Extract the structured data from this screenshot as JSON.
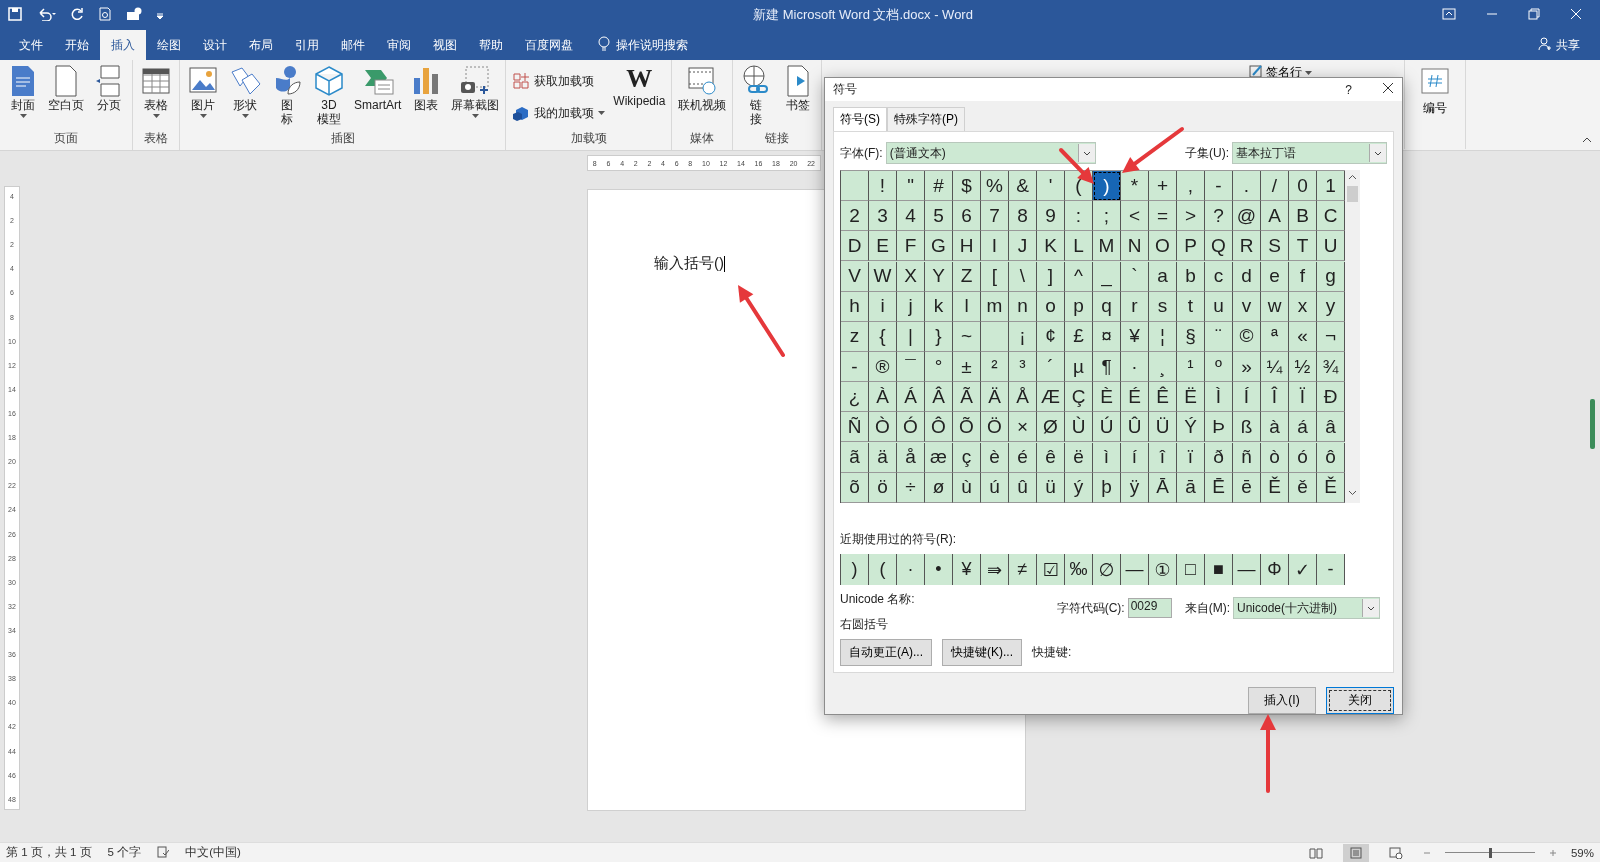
{
  "title_bar": {
    "title": "新建 Microsoft Word 文档.docx  -  Word"
  },
  "menu_tabs": [
    {
      "label": "文件",
      "selected": false
    },
    {
      "label": "开始",
      "selected": false
    },
    {
      "label": "插入",
      "selected": true
    },
    {
      "label": "绘图",
      "selected": false
    },
    {
      "label": "设计",
      "selected": false
    },
    {
      "label": "布局",
      "selected": false
    },
    {
      "label": "引用",
      "selected": false
    },
    {
      "label": "邮件",
      "selected": false
    },
    {
      "label": "审阅",
      "selected": false
    },
    {
      "label": "视图",
      "selected": false
    },
    {
      "label": "帮助",
      "selected": false
    },
    {
      "label": "百度网盘",
      "selected": false
    }
  ],
  "tell_me": "操作说明搜索",
  "share": "共享",
  "ribbon": {
    "groups": [
      {
        "label": "页面",
        "items": [
          {
            "label": "封面",
            "kind": "cover",
            "dropdown": true
          },
          {
            "label": "空白页",
            "kind": "blank",
            "dropdown": false
          },
          {
            "label": "分页",
            "kind": "pagebreak",
            "dropdown": false
          }
        ]
      },
      {
        "label": "表格",
        "items": [
          {
            "label": "表格",
            "kind": "table",
            "dropdown": true
          }
        ]
      },
      {
        "label": "插图",
        "items": [
          {
            "label": "图片",
            "kind": "picture",
            "dropdown": true
          },
          {
            "label": "形状",
            "kind": "shapes",
            "dropdown": true
          },
          {
            "label": "图标",
            "kind": "icons",
            "vertical": true,
            "dropdown": false
          },
          {
            "label": "3D\n模型",
            "kind": "model3d",
            "dropdown": false
          },
          {
            "label": "SmartArt",
            "kind": "smartart",
            "dropdown": false
          },
          {
            "label": "图表",
            "kind": "chart",
            "dropdown": false
          },
          {
            "label": "屏幕截图",
            "kind": "screenshot",
            "dropdown": true
          }
        ]
      },
      {
        "label": "加载项",
        "items": [
          {
            "label": "获取加载项",
            "kind": "store",
            "dropdown": false
          },
          {
            "label": "我的加载项",
            "kind": "myaddins",
            "dropdown": true
          },
          {
            "label": "Wikipedia",
            "kind": "wikipedia",
            "logo": "W",
            "dropdown": false
          }
        ]
      },
      {
        "label": "媒体",
        "items": [
          {
            "label": "联机视频",
            "kind": "video",
            "dropdown": false
          }
        ]
      },
      {
        "label": "链接",
        "items": [
          {
            "label": "链接",
            "kind": "link",
            "vertical": true,
            "dropdown": false
          },
          {
            "label": "书签",
            "kind": "bookmark",
            "dropdown": false
          }
        ]
      }
    ],
    "signature_line": "签名行",
    "numbering": "编号"
  },
  "document": {
    "text": "输入括号()",
    "ruler_numbers": [
      "8",
      "6",
      "4",
      "2",
      "2",
      "4",
      "6",
      "8",
      "10",
      "12",
      "14",
      "16",
      "18",
      "20",
      "22"
    ],
    "vertical_ruler_numbers": [
      "4",
      "2",
      "2",
      "4",
      "6",
      "8",
      "10",
      "12",
      "14",
      "16",
      "18",
      "20",
      "22",
      "24",
      "26",
      "28",
      "30",
      "32",
      "34",
      "36",
      "38",
      "40",
      "42",
      "44",
      "46",
      "48"
    ]
  },
  "symbol_dialog": {
    "title": "符号",
    "help": "?",
    "tabs": [
      {
        "label": "符号(S)",
        "selected": true
      },
      {
        "label": "特殊字符(P)",
        "selected": false
      }
    ],
    "font_label": "字体(F):",
    "font_value": "(普通文本)",
    "subset_label": "子集(U):",
    "subset_value": "基本拉丁语",
    "grid": [
      [
        {
          "selected": false
        },
        {
          "char": "!",
          "selected": false
        },
        {
          "char": "\"",
          "selected": false
        },
        {
          "char": "#",
          "selected": false
        },
        {
          "char": "$",
          "selected": false
        },
        {
          "char": "%",
          "selected": false
        },
        {
          "char": "&",
          "selected": false
        },
        {
          "char": "'",
          "selected": false
        },
        {
          "char": "(",
          "selected": false
        },
        {
          "char": ")",
          "selected": true
        },
        {
          "char": "*",
          "selected": false
        },
        {
          "char": "+",
          "selected": false
        },
        {
          "char": ",",
          "selected": false
        },
        {
          "char": "-",
          "selected": false
        },
        {
          "char": ".",
          "selected": false
        },
        {
          "char": "/",
          "selected": false
        },
        {
          "char": "0",
          "selected": false
        },
        {
          "char": "1",
          "selected": false
        }
      ],
      [
        {
          "char": "2",
          "selected": false
        },
        {
          "char": "3",
          "selected": false
        },
        {
          "char": "4",
          "selected": false
        },
        {
          "char": "5",
          "selected": false
        },
        {
          "char": "6",
          "selected": false
        },
        {
          "char": "7",
          "selected": false
        },
        {
          "char": "8",
          "selected": false
        },
        {
          "char": "9",
          "selected": false
        },
        {
          "char": ":",
          "selected": false
        },
        {
          "char": ";",
          "selected": false
        },
        {
          "char": "<",
          "selected": false
        },
        {
          "char": "=",
          "selected": false
        },
        {
          "char": ">",
          "selected": false
        },
        {
          "char": "?",
          "selected": false
        },
        {
          "char": "@",
          "selected": false
        },
        {
          "char": "A",
          "selected": false
        },
        {
          "char": "B",
          "selected": false
        },
        {
          "char": "C",
          "selected": false
        }
      ],
      [
        {
          "char": "D",
          "selected": false
        },
        {
          "char": "E",
          "selected": false
        },
        {
          "char": "F",
          "selected": false
        },
        {
          "char": "G",
          "selected": false
        },
        {
          "char": "H",
          "selected": false
        },
        {
          "char": "I",
          "selected": false
        },
        {
          "char": "J",
          "selected": false
        },
        {
          "char": "K",
          "selected": false
        },
        {
          "char": "L",
          "selected": false
        },
        {
          "char": "M",
          "selected": false
        },
        {
          "char": "N",
          "selected": false
        },
        {
          "char": "O",
          "selected": false
        },
        {
          "char": "P",
          "selected": false
        },
        {
          "char": "Q",
          "selected": false
        },
        {
          "char": "R",
          "selected": false
        },
        {
          "char": "S",
          "selected": false
        },
        {
          "char": "T",
          "selected": false
        },
        {
          "char": "U",
          "selected": false
        }
      ],
      [
        {
          "char": "V",
          "selected": false
        },
        {
          "char": "W",
          "selected": false
        },
        {
          "char": "X",
          "selected": false
        },
        {
          "char": "Y",
          "selected": false
        },
        {
          "char": "Z",
          "selected": false
        },
        {
          "char": "[",
          "selected": false
        },
        {
          "char": "\\",
          "selected": false
        },
        {
          "char": "]",
          "selected": false
        },
        {
          "char": "^",
          "selected": false
        },
        {
          "char": "_",
          "selected": false
        },
        {
          "char": "`",
          "selected": false
        },
        {
          "char": "a",
          "selected": false
        },
        {
          "char": "b",
          "selected": false
        },
        {
          "char": "c",
          "selected": false
        },
        {
          "char": "d",
          "selected": false
        },
        {
          "char": "e",
          "selected": false
        },
        {
          "char": "f",
          "selected": false
        },
        {
          "char": "g",
          "selected": false
        }
      ],
      [
        {
          "char": "h",
          "selected": false
        },
        {
          "char": "i",
          "selected": false
        },
        {
          "char": "j",
          "selected": false
        },
        {
          "char": "k",
          "selected": false
        },
        {
          "char": "l",
          "selected": false
        },
        {
          "char": "m",
          "selected": false
        },
        {
          "char": "n",
          "selected": false
        },
        {
          "char": "o",
          "selected": false
        },
        {
          "char": "p",
          "selected": false
        },
        {
          "char": "q",
          "selected": false
        },
        {
          "char": "r",
          "selected": false
        },
        {
          "char": "s",
          "selected": false
        },
        {
          "char": "t",
          "selected": false
        },
        {
          "char": "u",
          "selected": false
        },
        {
          "char": "v",
          "selected": false
        },
        {
          "char": "w",
          "selected": false
        },
        {
          "char": "x",
          "selected": false
        },
        {
          "char": "y",
          "selected": false
        }
      ],
      [
        {
          "char": "z",
          "selected": false
        },
        {
          "char": "{",
          "selected": false
        },
        {
          "char": "|",
          "selected": false
        },
        {
          "char": "}",
          "selected": false
        },
        {
          "char": "~",
          "selected": false
        },
        {
          "selected": false
        },
        {
          "char": "¡",
          "selected": false
        },
        {
          "char": "¢",
          "selected": false
        },
        {
          "char": "£",
          "selected": false
        },
        {
          "char": "¤",
          "selected": false
        },
        {
          "char": "¥",
          "selected": false
        },
        {
          "char": "¦",
          "selected": false
        },
        {
          "char": "§",
          "selected": false
        },
        {
          "char": "¨",
          "selected": false
        },
        {
          "char": "©",
          "selected": false
        },
        {
          "char": "ª",
          "selected": false
        },
        {
          "char": "«",
          "selected": false
        },
        {
          "char": "¬",
          "selected": false
        }
      ],
      [
        {
          "char": "-",
          "selected": false
        },
        {
          "char": "®",
          "selected": false
        },
        {
          "char": "¯",
          "selected": false
        },
        {
          "char": "°",
          "selected": false
        },
        {
          "char": "±",
          "selected": false
        },
        {
          "char": "²",
          "selected": false
        },
        {
          "char": "³",
          "selected": false
        },
        {
          "char": "´",
          "selected": false
        },
        {
          "char": "µ",
          "selected": false
        },
        {
          "char": "¶",
          "selected": false
        },
        {
          "char": "·",
          "selected": false
        },
        {
          "char": "¸",
          "selected": false
        },
        {
          "char": "¹",
          "selected": false
        },
        {
          "char": "º",
          "selected": false
        },
        {
          "char": "»",
          "selected": false
        },
        {
          "char": "¼",
          "selected": false
        },
        {
          "char": "½",
          "selected": false
        },
        {
          "char": "¾",
          "selected": false
        }
      ],
      [
        {
          "char": "¿",
          "selected": false
        },
        {
          "char": "À",
          "selected": false
        },
        {
          "char": "Á",
          "selected": false
        },
        {
          "char": "Â",
          "selected": false
        },
        {
          "char": "Ã",
          "selected": false
        },
        {
          "char": "Ä",
          "selected": false
        },
        {
          "char": "Å",
          "selected": false
        },
        {
          "char": "Æ",
          "selected": false
        },
        {
          "char": "Ç",
          "selected": false
        },
        {
          "char": "È",
          "selected": false
        },
        {
          "char": "É",
          "selected": false
        },
        {
          "char": "Ê",
          "selected": false
        },
        {
          "char": "Ë",
          "selected": false
        },
        {
          "char": "Ì",
          "selected": false
        },
        {
          "char": "Í",
          "selected": false
        },
        {
          "char": "Î",
          "selected": false
        },
        {
          "char": "Ï",
          "selected": false
        },
        {
          "char": "Ð",
          "selected": false
        }
      ],
      [
        {
          "char": "Ñ",
          "selected": false
        },
        {
          "char": "Ò",
          "selected": false
        },
        {
          "char": "Ó",
          "selected": false
        },
        {
          "char": "Ô",
          "selected": false
        },
        {
          "char": "Õ",
          "selected": false
        },
        {
          "char": "Ö",
          "selected": false
        },
        {
          "char": "×",
          "selected": false
        },
        {
          "char": "Ø",
          "selected": false
        },
        {
          "char": "Ù",
          "selected": false
        },
        {
          "char": "Ú",
          "selected": false
        },
        {
          "char": "Û",
          "selected": false
        },
        {
          "char": "Ü",
          "selected": false
        },
        {
          "char": "Ý",
          "selected": false
        },
        {
          "char": "Þ",
          "selected": false
        },
        {
          "char": "ß",
          "selected": false
        },
        {
          "char": "à",
          "selected": false
        },
        {
          "char": "á",
          "selected": false
        },
        {
          "char": "â",
          "selected": false
        }
      ],
      [
        {
          "char": "ã",
          "selected": false
        },
        {
          "char": "ä",
          "selected": false
        },
        {
          "char": "å",
          "selected": false
        },
        {
          "char": "æ",
          "selected": false
        },
        {
          "char": "ç",
          "selected": false
        },
        {
          "char": "è",
          "selected": false
        },
        {
          "char": "é",
          "selected": false
        },
        {
          "char": "ê",
          "selected": false
        },
        {
          "char": "ë",
          "selected": false
        },
        {
          "char": "ì",
          "selected": false
        },
        {
          "char": "í",
          "selected": false
        },
        {
          "char": "î",
          "selected": false
        },
        {
          "char": "ï",
          "selected": false
        },
        {
          "char": "ð",
          "selected": false
        },
        {
          "char": "ñ",
          "selected": false
        },
        {
          "char": "ò",
          "selected": false
        },
        {
          "char": "ó",
          "selected": false
        },
        {
          "char": "ô",
          "selected": false
        }
      ],
      [
        {
          "char": "õ",
          "selected": false
        },
        {
          "char": "ö",
          "selected": false
        },
        {
          "char": "÷",
          "selected": false
        },
        {
          "char": "ø",
          "selected": false
        },
        {
          "char": "ù",
          "selected": false
        },
        {
          "char": "ú",
          "selected": false
        },
        {
          "char": "û",
          "selected": false
        },
        {
          "char": "ü",
          "selected": false
        },
        {
          "char": "ý",
          "selected": false
        },
        {
          "char": "þ",
          "selected": false
        },
        {
          "char": "ÿ",
          "selected": false
        },
        {
          "char": "Ā",
          "selected": false
        },
        {
          "char": "ā",
          "selected": false
        },
        {
          "char": "Ē",
          "selected": false
        },
        {
          "char": "ē",
          "selected": false
        },
        {
          "char": "Ě",
          "selected": false
        },
        {
          "char": "ě",
          "selected": false
        },
        {
          "char": "Ě",
          "selected": false
        }
      ]
    ],
    "recent_label": "近期使用过的符号(R):",
    "recent": [
      ")",
      "(",
      "·",
      "•",
      "¥",
      "⇛",
      "≠",
      "☑",
      "‰",
      "∅",
      "—",
      "①",
      "□",
      "■",
      "—",
      "Φ",
      "✓",
      "-"
    ],
    "unicode_name_label": "Unicode 名称:",
    "unicode_name": "右圆括号",
    "char_code_label": "字符代码(C):",
    "char_code": "0029",
    "from_label": "来自(M):",
    "from_value": "Unicode(十六进制)",
    "autocorrect_button": "自动更正(A)...",
    "shortcut_button": "快捷键(K)...",
    "shortcut_label": "快捷键:",
    "insert_button": "插入(I)",
    "close_button": "关闭"
  },
  "status_bar": {
    "page": "第 1 页，共 1 页",
    "words": "5 个字",
    "language": "中文(中国)",
    "zoom": "59%",
    "zoom_slider": {
      "level": 0.5
    },
    "views": [
      {
        "kind": "read",
        "selected": false
      },
      {
        "kind": "print",
        "selected": true
      },
      {
        "kind": "web",
        "selected": false
      }
    ]
  }
}
